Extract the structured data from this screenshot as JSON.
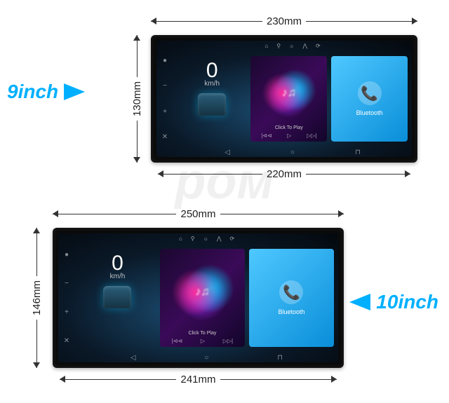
{
  "watermark": "ром",
  "products": {
    "a": {
      "size_label": "9inch",
      "dimensions": {
        "outer_width": "230mm",
        "outer_height": "130mm",
        "screen_width": "220mm"
      }
    },
    "b": {
      "size_label": "10inch",
      "dimensions": {
        "outer_width": "250mm",
        "outer_height": "146mm",
        "screen_width": "241mm"
      }
    }
  },
  "ui": {
    "speed_value": "0",
    "speed_unit": "km/h",
    "music": {
      "label": "Click To Play",
      "ctrl_prev": "|⊲⊲",
      "ctrl_play": "▷",
      "ctrl_next": "▷▷|"
    },
    "bluetooth": {
      "label": "Bluetooth"
    },
    "nav": {
      "back": "◁",
      "home": "○",
      "recent": "⊓"
    }
  }
}
